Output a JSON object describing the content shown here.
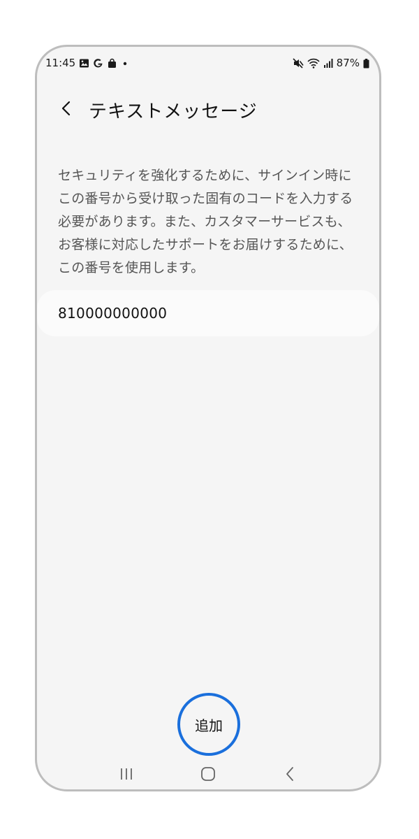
{
  "status_bar": {
    "time": "11:45",
    "battery": "87%",
    "icons": [
      "gallery-icon",
      "google-icon",
      "shopping-bag-icon",
      "dot-icon",
      "mute-icon",
      "wifi-icon",
      "signal-icon",
      "battery-icon"
    ]
  },
  "header": {
    "back_icon": "chevron-left-icon",
    "title": "テキストメッセージ"
  },
  "description": "セキュリティを強化するために、サインイン時にこの番号から受け取った固有のコードを入力する必要があります。また、カスタマーサービスも、お客様に対応したサポートをお届けするために、この番号を使用します。",
  "phone_number": "810000000000",
  "actions": {
    "add_label": "追加"
  },
  "colors": {
    "accent": "#1a6fdc",
    "background": "#f5f5f5"
  },
  "nav_bar": {
    "icons": [
      "recent-apps-icon",
      "home-icon",
      "back-icon"
    ]
  }
}
